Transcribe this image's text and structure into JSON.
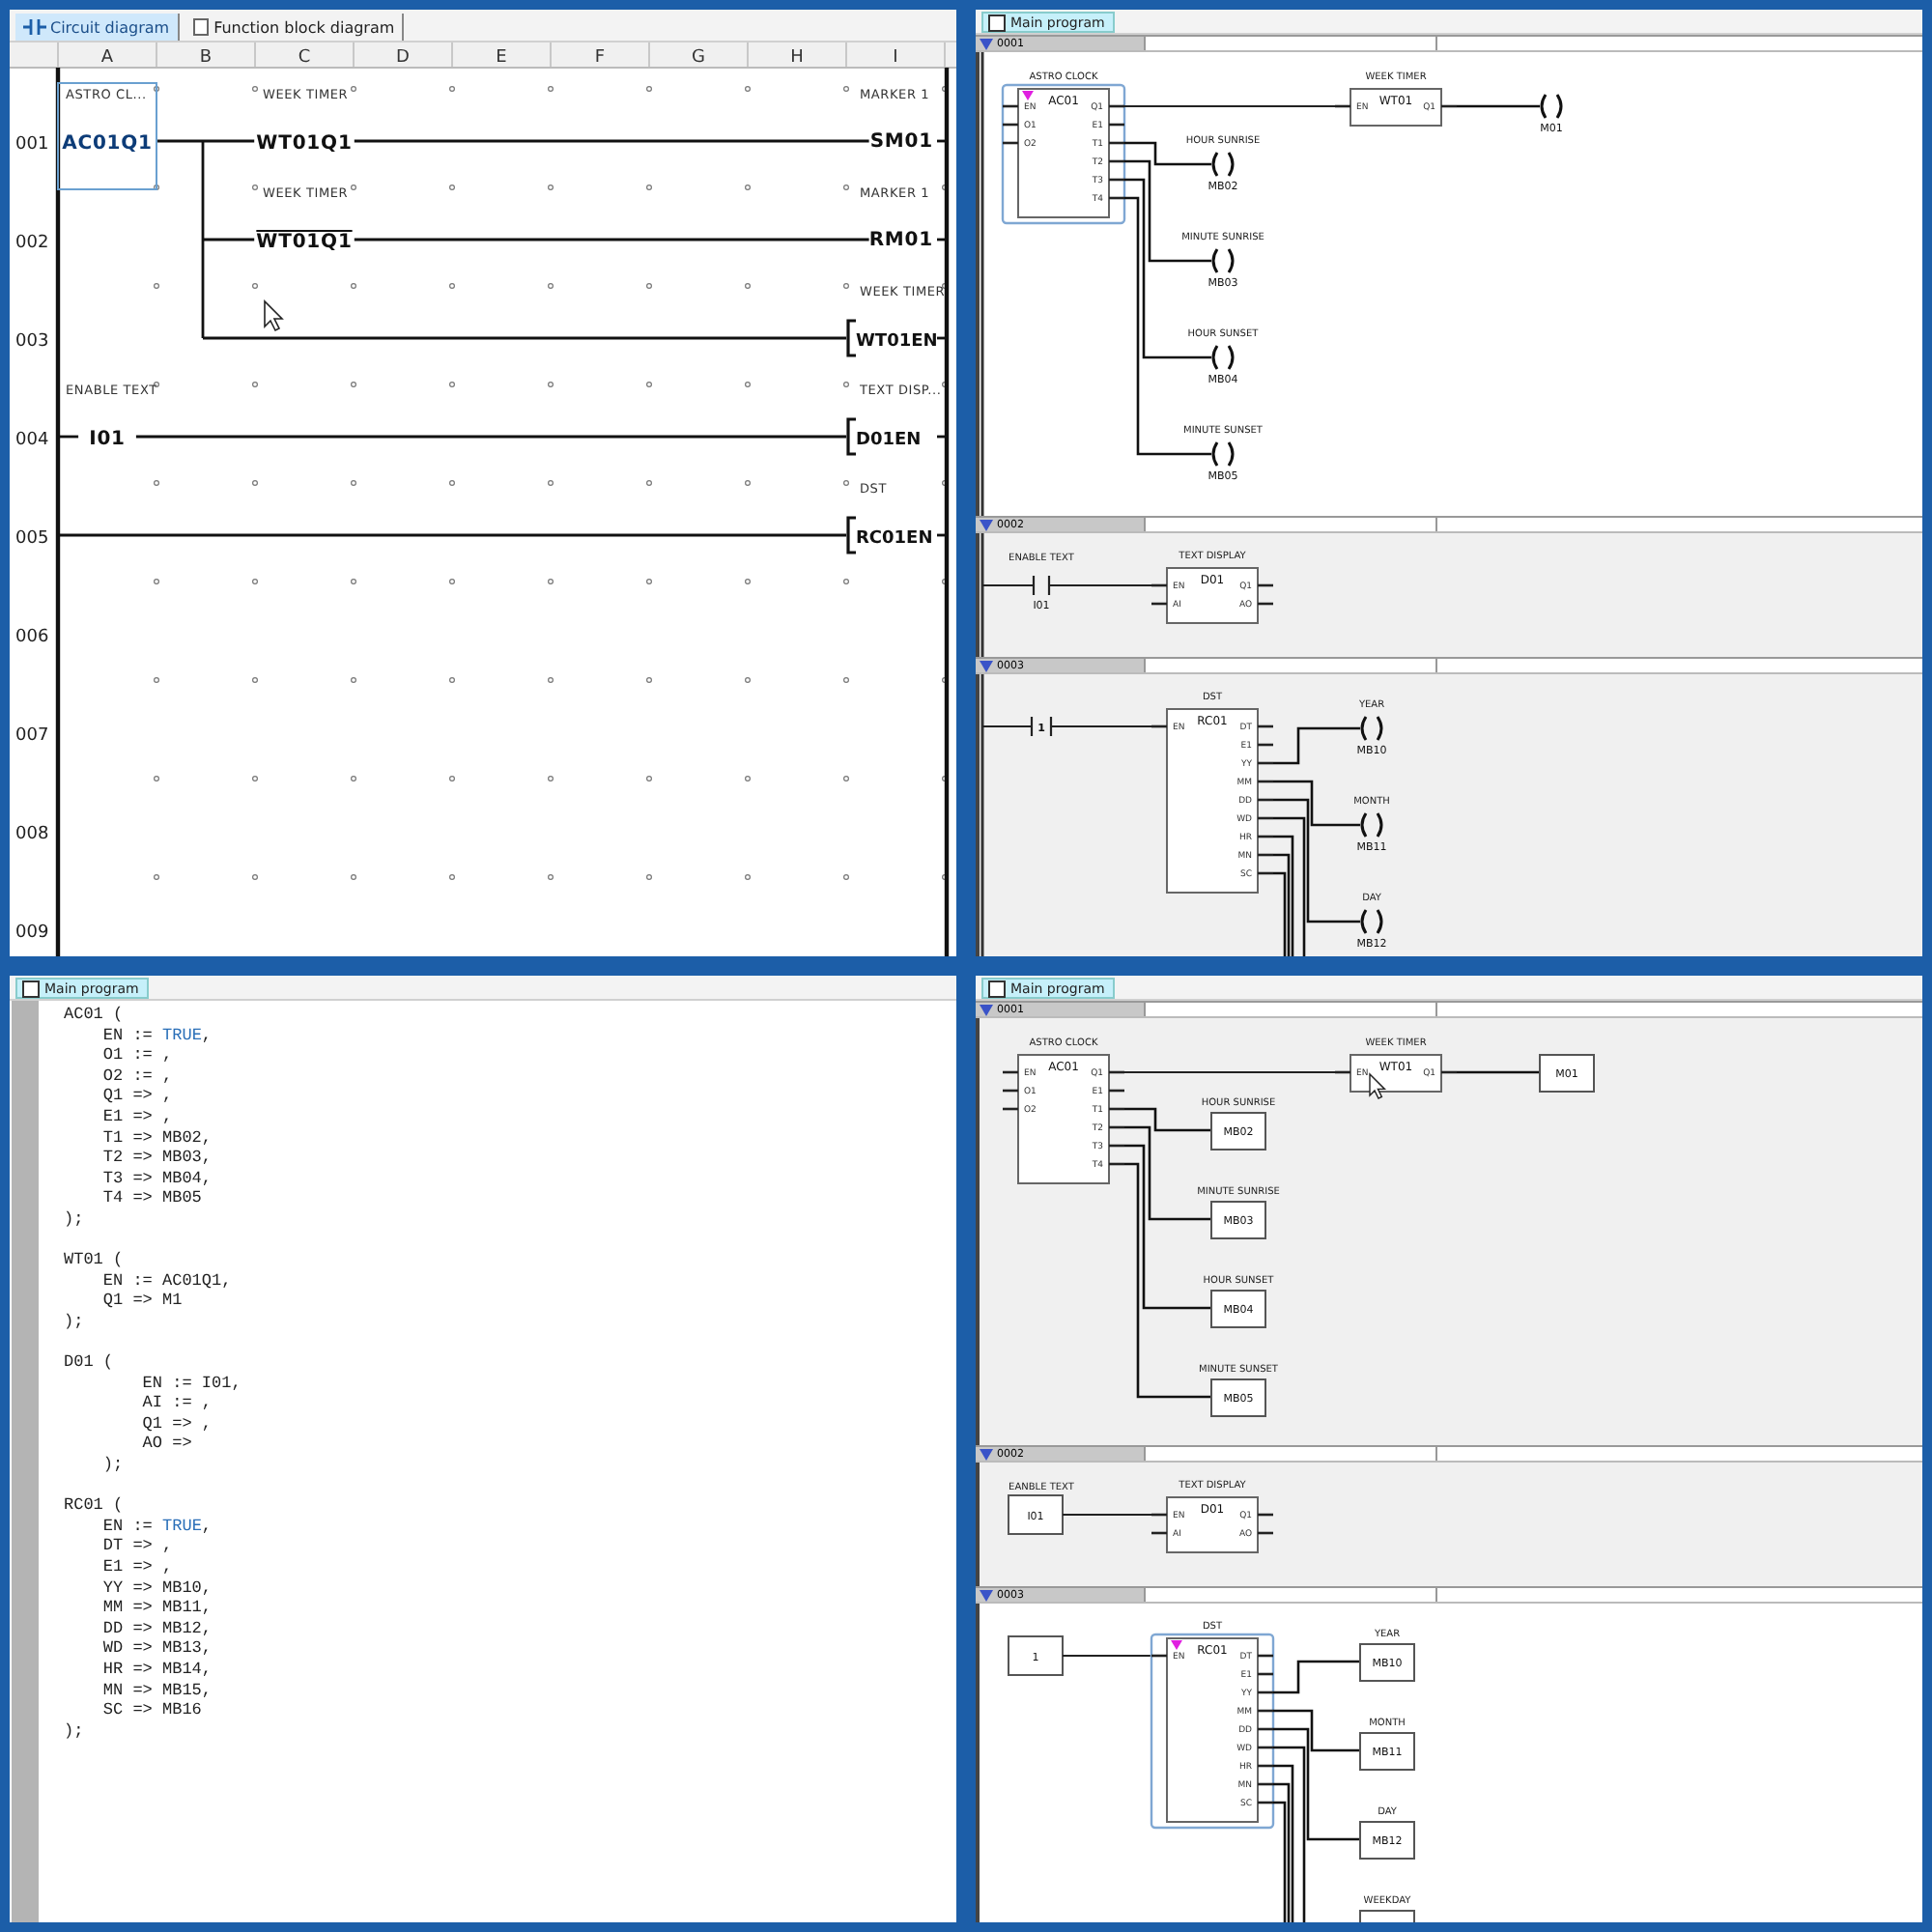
{
  "circuit_panel": {
    "tabs": [
      {
        "label": "Circuit diagram",
        "selected": true,
        "kind": "ladder"
      },
      {
        "label": "Function block diagram",
        "selected": false,
        "kind": "block"
      }
    ],
    "columns": [
      "A",
      "B",
      "C",
      "D",
      "E",
      "F",
      "G",
      "H",
      "I"
    ],
    "rows": [
      {
        "number": "001",
        "elements": [
          {
            "kind": "contact",
            "label": "ASTRO CL...",
            "operand": "AC01Q1",
            "negated": false,
            "selected": true
          },
          {
            "kind": "contact",
            "label": "WEEK TIMER",
            "operand": "WT01Q1",
            "negated": false,
            "selected": false
          },
          {
            "kind": "output",
            "label": "MARKER 1",
            "operand": "SM01",
            "selected": false
          }
        ]
      },
      {
        "number": "002",
        "elements": [
          {
            "kind": "contact",
            "label": "WEEK TIMER",
            "operand": "WT01Q1",
            "negated": true,
            "selected": false
          },
          {
            "kind": "output",
            "label": "MARKER 1",
            "operand": "RM01",
            "selected": false
          }
        ]
      },
      {
        "number": "003",
        "elements": [
          {
            "kind": "coil",
            "label": "WEEK TIMER",
            "operand": "WT01EN",
            "selected": false
          }
        ]
      },
      {
        "number": "004",
        "elements": [
          {
            "kind": "contact",
            "label": "ENABLE TEXT",
            "operand": "I01",
            "negated": false,
            "selected": false
          },
          {
            "kind": "coil",
            "label": "TEXT DISP...",
            "operand": "D01EN",
            "selected": false
          }
        ]
      },
      {
        "number": "005",
        "elements": [
          {
            "kind": "coil",
            "label": "DST",
            "operand": "RC01EN",
            "selected": false
          }
        ]
      },
      {
        "number": "006"
      },
      {
        "number": "007"
      },
      {
        "number": "008"
      },
      {
        "number": "009"
      }
    ]
  },
  "ladder_panel": {
    "tab": {
      "label": "Main program",
      "selected": true
    },
    "networks": [
      {
        "number": "0001",
        "selected": true,
        "blocks": [
          {
            "title": "ASTRO CLOCK",
            "name": "AC01",
            "inputs": [
              "EN",
              "O1",
              "O2"
            ],
            "outputs": [
              "Q1",
              "E1",
              "T1",
              "T2",
              "T3",
              "T4"
            ],
            "selected": true
          },
          {
            "title": "WEEK TIMER",
            "name": "WT01",
            "inputs": [
              "EN"
            ],
            "outputs": [
              "Q1"
            ],
            "selected": false
          }
        ],
        "outputs": [
          {
            "kind": "coil",
            "operand": "M01"
          },
          {
            "kind": "coil",
            "label": "HOUR SUNRISE",
            "operand": "MB02"
          },
          {
            "kind": "coil",
            "label": "MINUTE SUNRISE",
            "operand": "MB03"
          },
          {
            "kind": "coil",
            "label": "HOUR SUNSET",
            "operand": "MB04"
          },
          {
            "kind": "coil",
            "label": "MINUTE SUNSET",
            "operand": "MB05"
          }
        ]
      },
      {
        "number": "0002",
        "selected": false,
        "source": {
          "kind": "contact",
          "label": "ENABLE TEXT",
          "operand": "I01"
        },
        "blocks": [
          {
            "title": "TEXT DISPLAY",
            "name": "D01",
            "inputs": [
              "EN",
              "AI"
            ],
            "outputs": [
              "Q1",
              "AO"
            ],
            "selected": false
          }
        ]
      },
      {
        "number": "0003",
        "selected": false,
        "source": {
          "kind": "constant_contact",
          "operand": "1"
        },
        "blocks": [
          {
            "title": "DST",
            "name": "RC01",
            "inputs": [
              "EN"
            ],
            "outputs": [
              "DT",
              "E1",
              "YY",
              "MM",
              "DD",
              "WD",
              "HR",
              "MN",
              "SC"
            ],
            "selected": false
          }
        ],
        "outputs": [
          {
            "kind": "coil",
            "label": "YEAR",
            "operand": "MB10"
          },
          {
            "kind": "coil",
            "label": "MONTH",
            "operand": "MB11"
          },
          {
            "kind": "coil",
            "label": "DAY",
            "operand": "MB12"
          }
        ]
      }
    ]
  },
  "code_panel": {
    "tab": {
      "label": "Main program",
      "selected": true
    },
    "blocks": [
      {
        "lines": [
          {
            "code": "AC01 ("
          },
          {
            "code": "    EN := ",
            "keyword": "TRUE",
            "tail": ","
          },
          {
            "code": "    O1 := ,"
          },
          {
            "code": "    O2 := ,"
          },
          {
            "code": "    Q1 => ,"
          },
          {
            "code": "    E1 => ,"
          },
          {
            "code": "    T1 => MB02,"
          },
          {
            "code": "    T2 => MB03,"
          },
          {
            "code": "    T3 => MB04,"
          },
          {
            "code": "    T4 => MB05"
          },
          {
            "code": ");"
          }
        ]
      },
      {
        "lines": [
          {
            "code": "WT01 ("
          },
          {
            "code": "    EN := AC01Q1,"
          },
          {
            "code": "    Q1 => M1"
          },
          {
            "code": ");"
          }
        ]
      },
      {
        "lines": [
          {
            "code": "D01 ("
          },
          {
            "code": "        EN := I01,"
          },
          {
            "code": "        AI := ,"
          },
          {
            "code": "        Q1 => ,"
          },
          {
            "code": "        AO =>"
          },
          {
            "code": "    );"
          }
        ]
      },
      {
        "lines": [
          {
            "code": "RC01 ("
          },
          {
            "code": "    EN := ",
            "keyword": "TRUE",
            "tail": ","
          },
          {
            "code": "    DT => ,"
          },
          {
            "code": "    E1 => ,"
          },
          {
            "code": "    YY => MB10,"
          },
          {
            "code": "    MM => MB11,"
          },
          {
            "code": "    DD => MB12,"
          },
          {
            "code": "    WD => MB13,"
          },
          {
            "code": "    HR => MB14,"
          },
          {
            "code": "    MN => MB15,"
          },
          {
            "code": "    SC => MB16"
          },
          {
            "code": ");"
          }
        ]
      }
    ]
  },
  "fbd_panel": {
    "tab": {
      "label": "Main program",
      "selected": true
    },
    "networks": [
      {
        "number": "0001",
        "selected": false,
        "blocks": [
          {
            "title": "ASTRO CLOCK",
            "name": "AC01",
            "inputs": [
              "EN",
              "O1",
              "O2"
            ],
            "outputs": [
              "Q1",
              "E1",
              "T1",
              "T2",
              "T3",
              "T4"
            ],
            "selected": false
          },
          {
            "title": "WEEK TIMER",
            "name": "WT01",
            "inputs": [
              "EN"
            ],
            "outputs": [
              "Q1"
            ],
            "selected": false
          }
        ],
        "outputs": [
          {
            "kind": "box",
            "operand": "M01"
          },
          {
            "kind": "box",
            "label": "HOUR SUNRISE",
            "operand": "MB02"
          },
          {
            "kind": "box",
            "label": "MINUTE SUNRISE",
            "operand": "MB03"
          },
          {
            "kind": "box",
            "label": "HOUR SUNSET",
            "operand": "MB04"
          },
          {
            "kind": "box",
            "label": "MINUTE SUNSET",
            "operand": "MB05"
          }
        ]
      },
      {
        "number": "0002",
        "selected": false,
        "source": {
          "kind": "input_box",
          "label": "EANBLE TEXT",
          "operand": "I01"
        },
        "blocks": [
          {
            "title": "TEXT DISPLAY",
            "name": "D01",
            "inputs": [
              "EN",
              "AI"
            ],
            "outputs": [
              "Q1",
              "AO"
            ],
            "selected": false
          }
        ]
      },
      {
        "number": "0003",
        "selected": true,
        "source": {
          "kind": "input_box",
          "operand": "1"
        },
        "blocks": [
          {
            "title": "DST",
            "name": "RC01",
            "inputs": [
              "EN"
            ],
            "outputs": [
              "DT",
              "E1",
              "YY",
              "MM",
              "DD",
              "WD",
              "HR",
              "MN",
              "SC"
            ],
            "selected": true
          }
        ],
        "outputs": [
          {
            "kind": "box",
            "label": "YEAR",
            "operand": "MB10"
          },
          {
            "kind": "box",
            "label": "MONTH",
            "operand": "MB11"
          },
          {
            "kind": "box",
            "label": "DAY",
            "operand": "MB12"
          },
          {
            "kind": "box",
            "label": "WEEKDAY"
          }
        ]
      }
    ]
  }
}
